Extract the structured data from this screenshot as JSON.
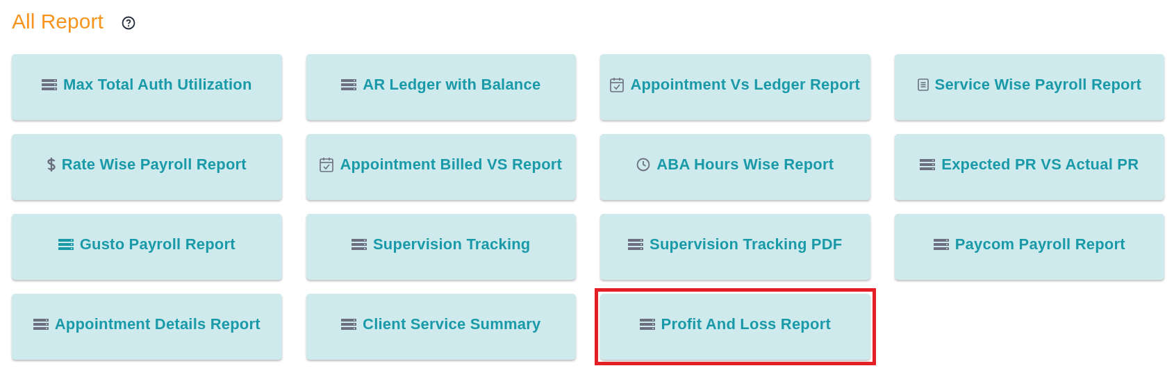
{
  "title": "All Report",
  "reports": [
    {
      "label": "Max Total Auth Utilization",
      "kind": "server",
      "accent_icon": false,
      "highlighted": false
    },
    {
      "label": "AR Ledger with Balance",
      "kind": "server",
      "accent_icon": false,
      "highlighted": false
    },
    {
      "label": "Appointment Vs Ledger Report",
      "kind": "calendar",
      "accent_icon": false,
      "highlighted": false
    },
    {
      "label": "Service Wise Payroll Report",
      "kind": "document",
      "accent_icon": false,
      "highlighted": false
    },
    {
      "label": "Rate Wise Payroll Report",
      "kind": "dollar",
      "accent_icon": false,
      "highlighted": false
    },
    {
      "label": "Appointment Billed VS Report",
      "kind": "calendar",
      "accent_icon": false,
      "highlighted": false
    },
    {
      "label": "ABA Hours Wise Report",
      "kind": "clock",
      "accent_icon": false,
      "highlighted": false
    },
    {
      "label": "Expected PR VS Actual PR",
      "kind": "server",
      "accent_icon": false,
      "highlighted": false
    },
    {
      "label": "Gusto Payroll Report",
      "kind": "server",
      "accent_icon": true,
      "highlighted": false
    },
    {
      "label": "Supervision Tracking",
      "kind": "server",
      "accent_icon": false,
      "highlighted": false
    },
    {
      "label": "Supervision Tracking PDF",
      "kind": "server",
      "accent_icon": false,
      "highlighted": false
    },
    {
      "label": "Paycom Payroll Report",
      "kind": "server",
      "accent_icon": false,
      "highlighted": false
    },
    {
      "label": "Appointment Details Report",
      "kind": "server",
      "accent_icon": false,
      "highlighted": false
    },
    {
      "label": "Client Service Summary",
      "kind": "server",
      "accent_icon": false,
      "highlighted": false
    },
    {
      "label": "Profit And Loss Report",
      "kind": "server",
      "accent_icon": false,
      "highlighted": true
    }
  ]
}
